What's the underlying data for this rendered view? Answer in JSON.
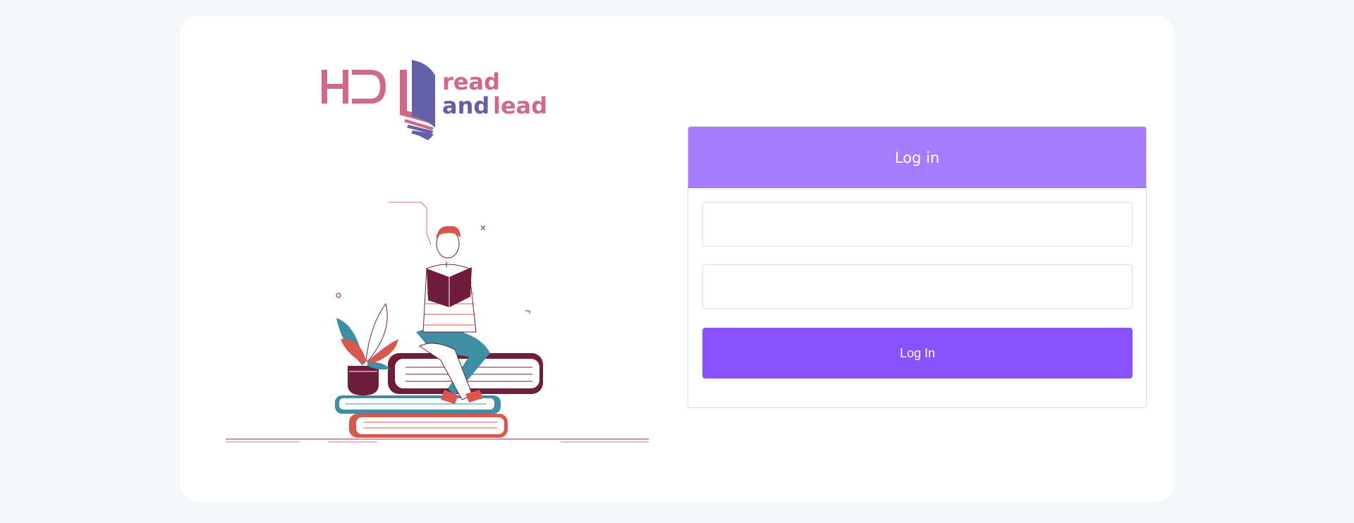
{
  "brand": {
    "logo_text_line1": "read",
    "logo_text_line2_part1": "and",
    "logo_text_line2_part2": "lead",
    "mark_icon": "hd-logo-icon",
    "colors": {
      "pink": "#d0688e",
      "purple": "#6360a8"
    }
  },
  "login": {
    "header_title": "Log in",
    "username_value": "",
    "password_value": "",
    "button_label": "Log In",
    "colors": {
      "header": "#a57cff",
      "button": "#8a52ff"
    }
  },
  "illustration": {
    "icon": "reading-person-illustration"
  }
}
